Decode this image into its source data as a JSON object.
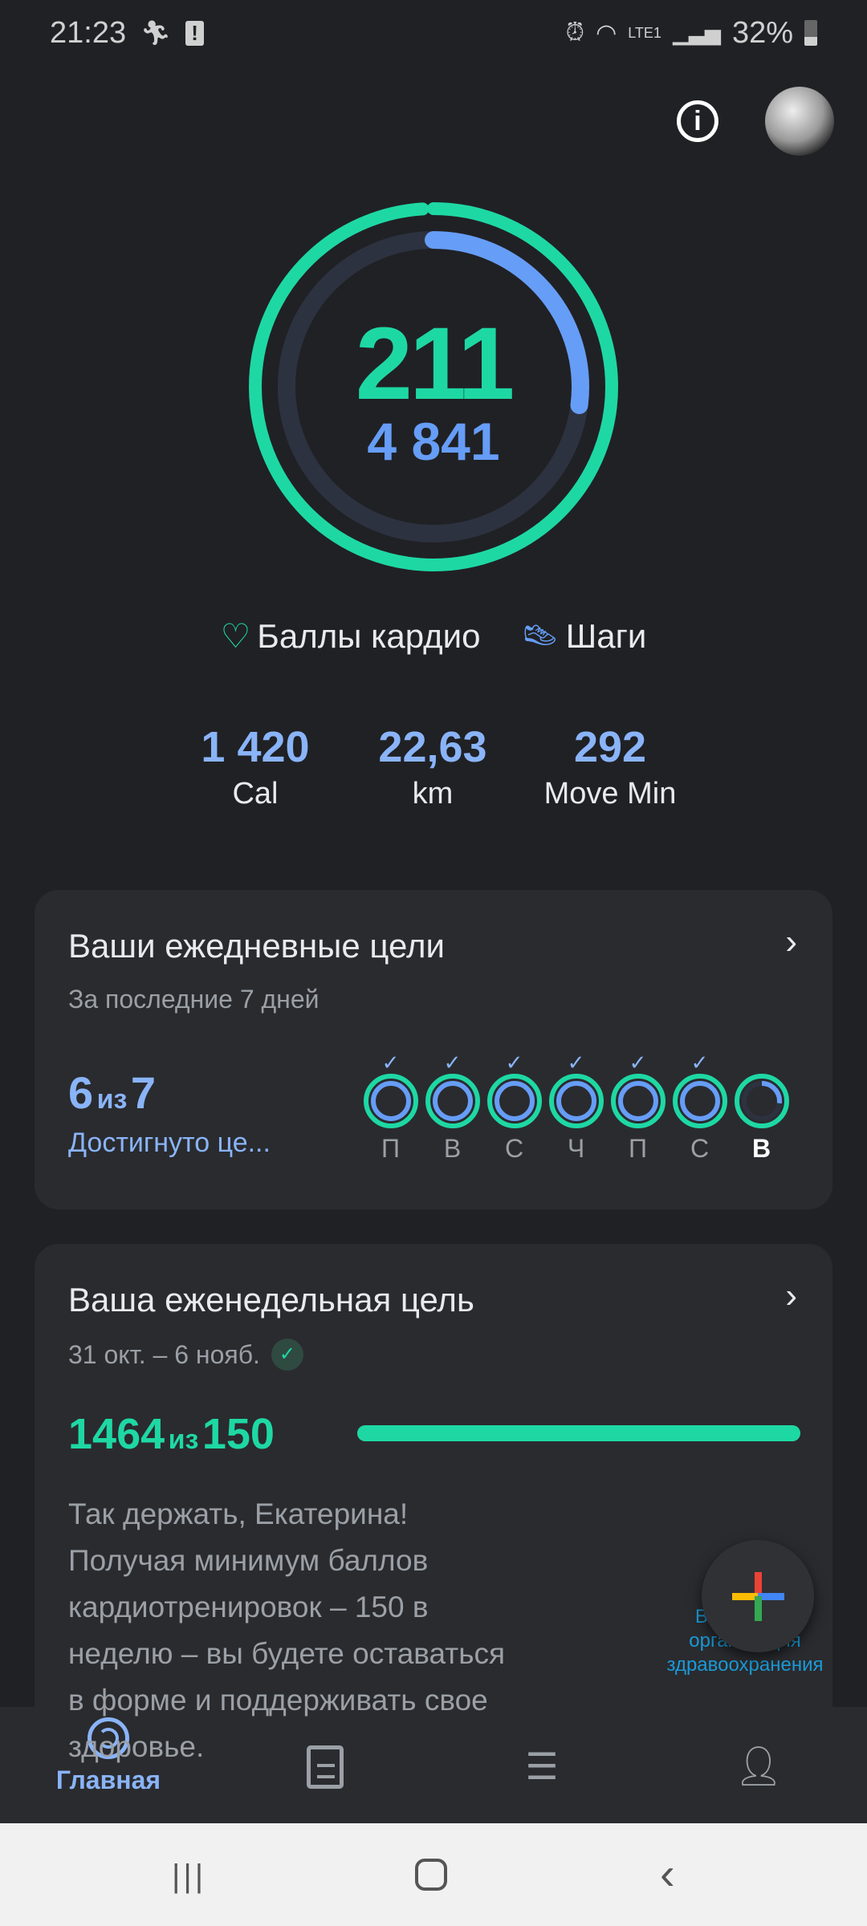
{
  "status_bar": {
    "time": "21:23",
    "battery": "32%",
    "network": "LTE1"
  },
  "header": {
    "info_icon": "info-icon",
    "avatar": "avatar"
  },
  "ring": {
    "heart_points": "211",
    "steps": "4 841",
    "heart_points_goal_fraction": 0.99,
    "steps_goal_fraction": 0.27,
    "colors": {
      "heart": "#1ed8a4",
      "steps": "#669df6"
    }
  },
  "legend": {
    "cardio_label": "Баллы кардио",
    "steps_label": "Шаги"
  },
  "stats": [
    {
      "value": "1 420",
      "label": "Cal"
    },
    {
      "value": "22,63",
      "label": "km"
    },
    {
      "value": "292",
      "label": "Move Min"
    }
  ],
  "daily_goals": {
    "title": "Ваши ежедневные цели",
    "subtitle": "За последние 7 дней",
    "achieved": "6",
    "of": "из",
    "total": "7",
    "caption": "Достигнуто це...",
    "days": [
      {
        "label": "П",
        "done": true,
        "steps_fraction": 1
      },
      {
        "label": "В",
        "done": true,
        "steps_fraction": 1
      },
      {
        "label": "С",
        "done": true,
        "steps_fraction": 1
      },
      {
        "label": "Ч",
        "done": true,
        "steps_fraction": 1
      },
      {
        "label": "П",
        "done": true,
        "steps_fraction": 1
      },
      {
        "label": "С",
        "done": true,
        "steps_fraction": 1
      },
      {
        "label": "В",
        "done": false,
        "steps_fraction": 0.27
      }
    ]
  },
  "weekly_goal": {
    "title": "Ваша еженедельная цель",
    "dates": "31 окт. – 6 нояб.",
    "value": "1464",
    "of": "из",
    "goal": "150",
    "progress_fraction": 1.0,
    "message_lines": [
      "Так держать, Екатерина!",
      "Получая минимум баллов",
      "кардиотренировок – 150 в",
      "неделю – вы будете оставаться",
      "в форме и поддерживать свое",
      "здоровье."
    ],
    "who_logo_text": [
      "Всемирная",
      "организация",
      "здравоохранения"
    ]
  },
  "bottom_nav": [
    {
      "label": "Главная",
      "icon": "home-ring-icon",
      "active": true
    },
    {
      "label": "",
      "icon": "journal-icon"
    },
    {
      "label": "",
      "icon": "browse-list-icon"
    },
    {
      "label": "",
      "icon": "profile-icon"
    }
  ],
  "system_nav": {
    "recent": "recent-apps-icon",
    "home": "home-icon",
    "back": "back-icon"
  }
}
